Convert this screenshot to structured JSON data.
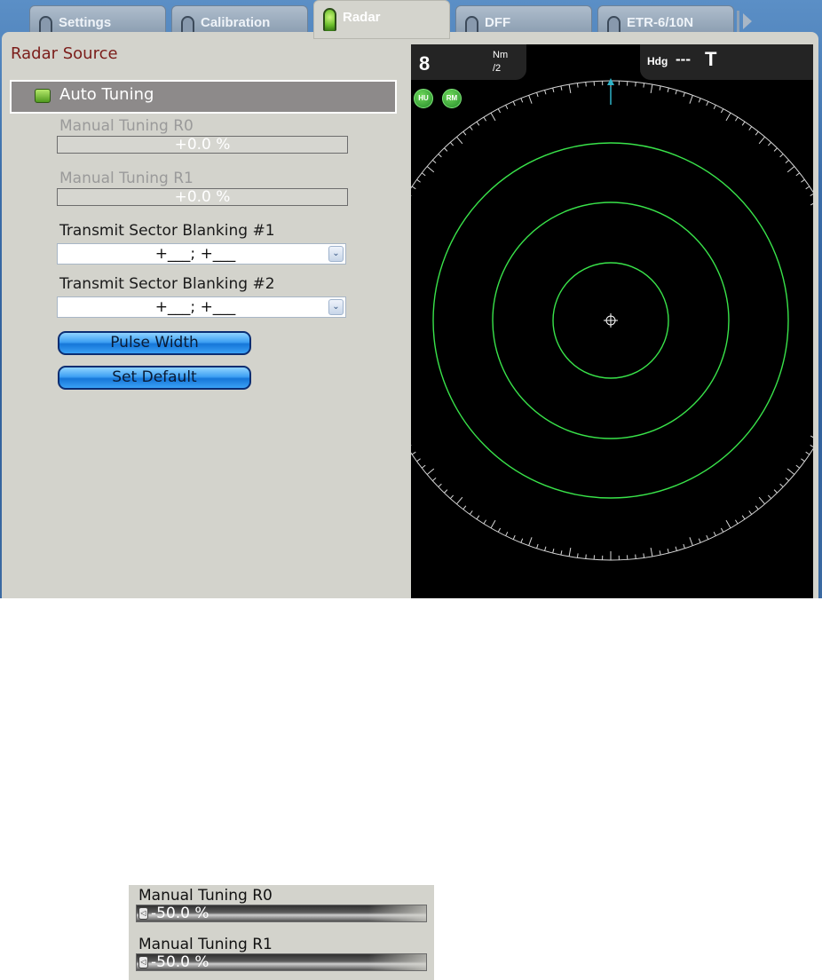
{
  "tabs": [
    {
      "label": "Settings",
      "active": false
    },
    {
      "label": "Calibration",
      "active": false
    },
    {
      "label": "Radar",
      "active": true
    },
    {
      "label": "DFF",
      "active": false
    },
    {
      "label": "ETR-6/10N",
      "active": false
    }
  ],
  "panel": {
    "section_title": "Radar Source",
    "auto_tuning": {
      "label": "Auto Tuning",
      "enabled": true
    },
    "manual_r0": {
      "label": "Manual Tuning R0",
      "value": "+0.0 %",
      "enabled": false
    },
    "manual_r1": {
      "label": "Manual Tuning R1",
      "value": "+0.0 %",
      "enabled": false
    },
    "blanking1": {
      "label": "Transmit Sector Blanking #1",
      "value": "+___; +___"
    },
    "blanking2": {
      "label": "Transmit Sector Blanking #2",
      "value": "+___; +___"
    },
    "pulse_width_label": "Pulse Width",
    "set_default_label": "Set Default"
  },
  "radar": {
    "range": "8",
    "range_unit": "Nm",
    "range_ring_divider": "/2",
    "heading_label": "Hdg",
    "heading_value": "---",
    "heading_ref": "T",
    "mode_hu": "HU",
    "mode_rm": "RM",
    "colors": {
      "rings": "#39e34a",
      "scale": "#d8d8d8",
      "heading_marker": "#2fb3c7"
    }
  },
  "inset": {
    "r0": {
      "label": "Manual Tuning R0",
      "value": "-50.0 %"
    },
    "r1": {
      "label": "Manual Tuning R1",
      "value": "-50.0 %"
    }
  }
}
